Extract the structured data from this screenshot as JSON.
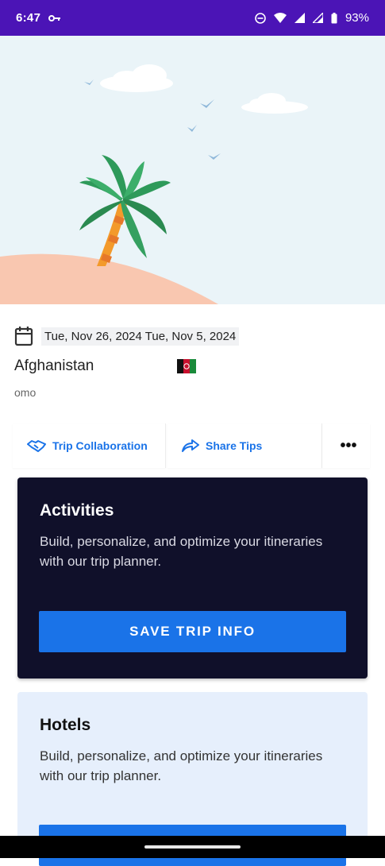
{
  "status_bar": {
    "time": "6:47",
    "battery": "93%"
  },
  "trip": {
    "dates": "Tue, Nov 26, 2024 Tue, Nov 5, 2024",
    "country": "Afghanistan",
    "subtitle": "omo"
  },
  "actions": {
    "collaboration_label": "Trip Collaboration",
    "share_label": "Share Tips",
    "more_label": "•••"
  },
  "cards": [
    {
      "title": "Activities",
      "description": "Build, personalize, and optimize your itineraries with our trip planner.",
      "button_label": "SAVE TRIP INFO"
    },
    {
      "title": "Hotels",
      "description": "Build, personalize, and optimize your itineraries with our trip planner.",
      "button_label": ""
    }
  ],
  "colors": {
    "status_bar": "#4b14b6",
    "accent": "#1a73e8",
    "dark_card": "#10102a",
    "light_card": "#e6effc",
    "hero_bg": "#eaf4f8"
  }
}
